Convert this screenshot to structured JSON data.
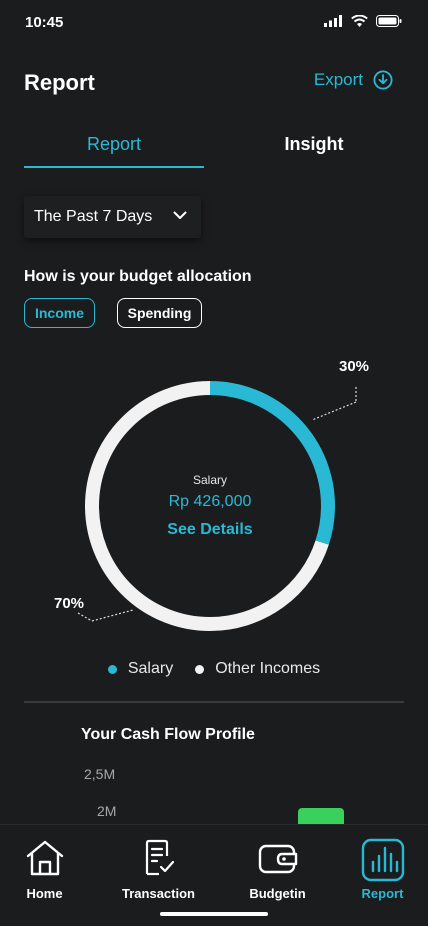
{
  "status_bar": {
    "time": "10:45"
  },
  "header": {
    "title": "Report",
    "export_label": "Export"
  },
  "tabs": [
    {
      "label": "Report",
      "active": true
    },
    {
      "label": "Insight",
      "active": false
    }
  ],
  "period": {
    "selected": "The Past 7 Days"
  },
  "allocation": {
    "title": "How is your budget allocation",
    "filters": [
      {
        "label": "Income",
        "active": true
      },
      {
        "label": "Spending",
        "active": false
      }
    ]
  },
  "chart_data": {
    "type": "pie",
    "variant": "donut",
    "slices": [
      {
        "name": "Salary",
        "value": 30,
        "label": "30%",
        "color": "#2ab9d4"
      },
      {
        "name": "Other Incomes",
        "value": 70,
        "label": "70%",
        "color": "#f2f2f2"
      }
    ],
    "center": {
      "name": "Salary",
      "value": "Rp 426,000",
      "link": "See Details"
    },
    "legend": [
      "Salary",
      "Other Incomes"
    ],
    "legend_placement": "bottom"
  },
  "cash_flow": {
    "title": "Your Cash Flow Profile",
    "y_ticks": [
      "2,5M",
      "2M"
    ]
  },
  "colors": {
    "accent": "#2ab9d4",
    "background": "#1b1c1e",
    "bar": "#39d15b"
  },
  "nav": [
    {
      "label": "Home",
      "icon": "home-icon",
      "active": false
    },
    {
      "label": "Transaction",
      "icon": "receipt-icon",
      "active": false
    },
    {
      "label": "Budgetin",
      "icon": "wallet-icon",
      "active": false
    },
    {
      "label": "Report",
      "icon": "chart-icon",
      "active": true
    }
  ]
}
